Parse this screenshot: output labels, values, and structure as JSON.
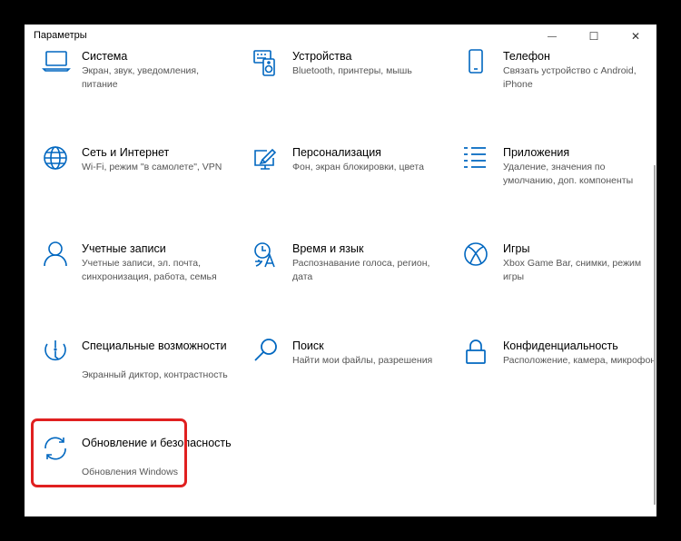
{
  "window": {
    "title": "Параметры",
    "minimize": "—",
    "maximize": "☐",
    "close": "✕"
  },
  "tiles": [
    {
      "name": "Система",
      "desc": "Экран, звук, уведомления, питание",
      "icon": "laptop-icon"
    },
    {
      "name": "Устройства",
      "desc": "Bluetooth, принтеры, мышь",
      "icon": "keyboard-speaker-icon"
    },
    {
      "name": "Телефон",
      "desc": "Связать устройство с Android, iPhone",
      "icon": "phone-icon"
    },
    {
      "name": "Сеть и Интернет",
      "desc": "Wi-Fi, режим \"в самолете\", VPN",
      "icon": "globe-icon"
    },
    {
      "name": "Персонализация",
      "desc": "Фон, экран блокировки, цвета",
      "icon": "paint-icon"
    },
    {
      "name": "Приложения",
      "desc": "Удаление, значения по умолчанию, доп. компоненты",
      "icon": "apps-list-icon"
    },
    {
      "name": "Учетные записи",
      "desc": "Учетные записи, эл. почта, синхронизация, работа, семья",
      "icon": "person-icon"
    },
    {
      "name": "Время и язык",
      "desc": "Распознавание голоса, регион, дата",
      "icon": "time-language-icon"
    },
    {
      "name": "Игры",
      "desc": "Xbox Game Bar, снимки, режим игры",
      "icon": "xbox-icon"
    },
    {
      "name": "Специальные возможности",
      "desc": "Экранный диктор, контрастность",
      "icon": "ease-of-access-icon"
    },
    {
      "name": "Поиск",
      "desc": "Найти мои файлы, разрешения",
      "icon": "search-icon"
    },
    {
      "name": "Конфиденциальность",
      "desc": "Расположение, камера, микрофон",
      "icon": "lock-icon"
    },
    {
      "name": "Обновление и безопасность",
      "desc": "Обновления Windows",
      "icon": "sync-icon"
    }
  ],
  "colors": {
    "accent": "#0067c0",
    "highlight": "#e02020"
  }
}
